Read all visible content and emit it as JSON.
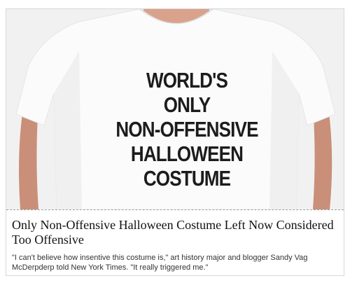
{
  "image": {
    "shirt_lines": [
      "WORLD'S",
      "ONLY",
      "NON-OFFENSIVE",
      "HALLOWEEN",
      "COSTUME"
    ]
  },
  "article": {
    "headline": "Only Non-Offensive Halloween Costume Left Now Considered Too Offensive",
    "excerpt": "\"I can't believe how insentive this costume is,\" art history major and blogger Sandy Vag McDerpderp told New York Times. \"It really triggered me.\""
  },
  "colors": {
    "background": "#f2f2f2",
    "shirt": "#fafafa",
    "skin": "#d9a28c",
    "text": "#111111"
  }
}
